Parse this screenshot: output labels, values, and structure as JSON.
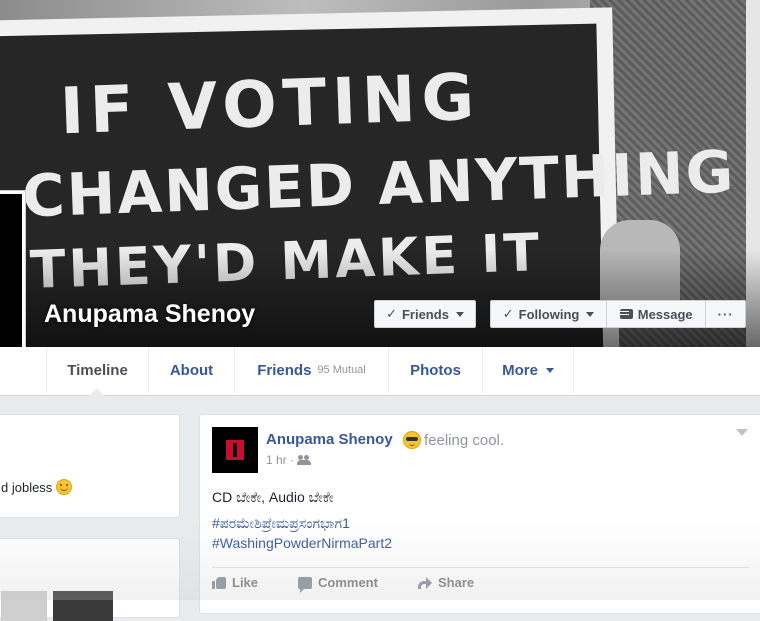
{
  "cover": {
    "sign_lines": [
      "IF VOTING",
      "CHANGED ANYTHING",
      "THEY'D MAKE IT"
    ],
    "profile_name": "Anupama Shenoy"
  },
  "cover_buttons": {
    "friends": "Friends",
    "following": "Following",
    "message": "Message",
    "more": "···"
  },
  "nav": {
    "timeline": "Timeline",
    "about": "About",
    "friends": "Friends",
    "friends_mutual": "95 Mutual",
    "photos": "Photos",
    "more": "More"
  },
  "left_column": {
    "snippet": "d jobless"
  },
  "post": {
    "author": "Anupama Shenoy",
    "feeling": "feeling cool.",
    "time": "1 hr ·",
    "text": "CD ಬೇಕೇ, Audio ಬೇಕೇ",
    "hashtags": [
      "#ಪರಮೇಶಿಪ್ರೇಮಪ್ರಸಂಗಭಾಗ1",
      "#WashingPowderNirmaPart2"
    ],
    "actions": {
      "like": "Like",
      "comment": "Comment",
      "share": "Share"
    }
  },
  "colors": {
    "link_blue": "#365899",
    "page_bg": "#e9ebee",
    "meta_gray": "#90949c"
  }
}
